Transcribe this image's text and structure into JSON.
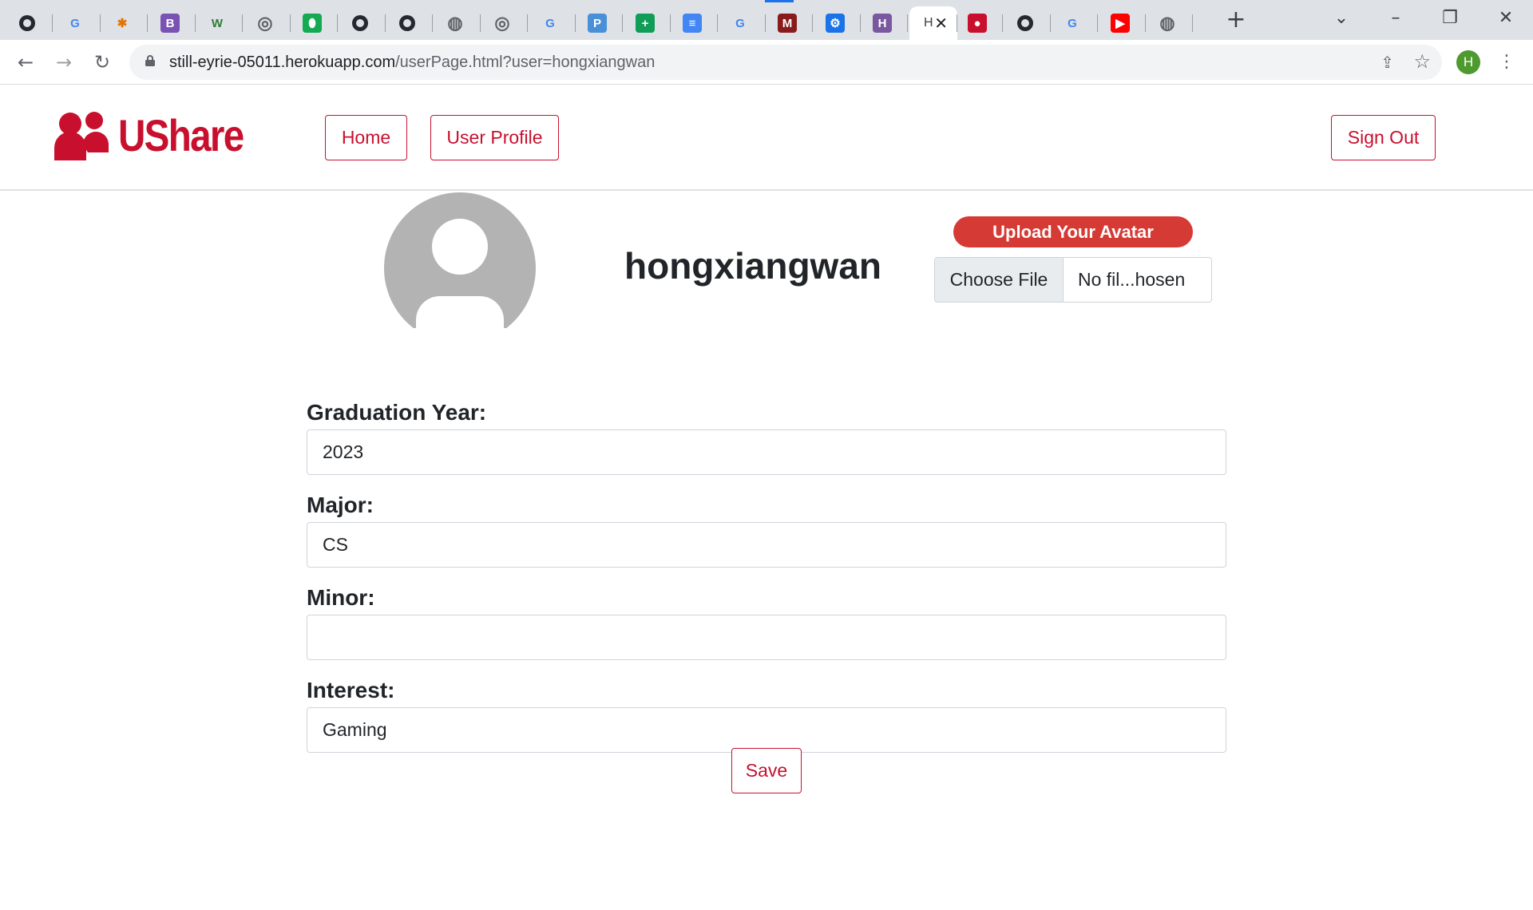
{
  "browser": {
    "tabs": [
      {
        "icon": "github-icon",
        "color": "#24292f",
        "glyph": ""
      },
      {
        "icon": "google-icon",
        "color": "#ffffff",
        "glyph": "G"
      },
      {
        "icon": "sparkle-icon",
        "color": "#ffffff",
        "glyph": "✱"
      },
      {
        "icon": "bootstrap-icon",
        "color": "#7952b3",
        "glyph": "B"
      },
      {
        "icon": "w-icon",
        "color": "#ffffff",
        "glyph": "W"
      },
      {
        "icon": "chrome-icon",
        "color": "#5f6368",
        "glyph": "◎"
      },
      {
        "icon": "mongodb-icon",
        "color": "#13aa52",
        "glyph": "⬮"
      },
      {
        "icon": "github-icon",
        "color": "#24292f",
        "glyph": ""
      },
      {
        "icon": "github-icon",
        "color": "#24292f",
        "glyph": ""
      },
      {
        "icon": "globe-icon",
        "color": "#5f6368",
        "glyph": "◍"
      },
      {
        "icon": "chrome-icon",
        "color": "#5f6368",
        "glyph": "◎"
      },
      {
        "icon": "google-icon",
        "color": "#ffffff",
        "glyph": "G"
      },
      {
        "icon": "p-icon",
        "color": "#4a90d9",
        "glyph": "P"
      },
      {
        "icon": "sheets-icon",
        "color": "#0f9d58",
        "glyph": "+"
      },
      {
        "icon": "docs-icon",
        "color": "#4285f4",
        "glyph": "≡"
      },
      {
        "icon": "google-icon",
        "color": "#ffffff",
        "glyph": "G"
      },
      {
        "icon": "umass-icon",
        "color": "#881c1c",
        "glyph": "M"
      },
      {
        "icon": "gear-icon",
        "color": "#1a73e8",
        "glyph": "⚙"
      },
      {
        "icon": "heroku-icon",
        "color": "#79589f",
        "glyph": "H"
      },
      {
        "icon": "page-icon",
        "color": "#ffffff",
        "glyph": "",
        "active": true,
        "label": "H"
      },
      {
        "icon": "ushare-icon",
        "color": "#c8102e",
        "glyph": "●"
      },
      {
        "icon": "github-icon",
        "color": "#24292f",
        "glyph": ""
      },
      {
        "icon": "google-icon",
        "color": "#ffffff",
        "glyph": "G"
      },
      {
        "icon": "youtube-icon",
        "color": "#ff0000",
        "glyph": "▶"
      },
      {
        "icon": "globe-icon",
        "color": "#5f6368",
        "glyph": "◍"
      }
    ],
    "url_host": "still-eyrie-05011.herokuapp.com",
    "url_path": "/userPage.html?user=hongxiangwan",
    "profile_initial": "H"
  },
  "header": {
    "logo_text": "UShare",
    "nav": {
      "home": "Home",
      "user_profile": "User Profile",
      "sign_out": "Sign Out"
    }
  },
  "profile": {
    "username": "hongxiangwan",
    "upload_label": "Upload Your Avatar",
    "choose_file": "Choose File",
    "no_file": "No fil...hosen"
  },
  "form": {
    "fields": [
      {
        "label": "Graduation Year:",
        "value": "2023"
      },
      {
        "label": "Major:",
        "value": "CS"
      },
      {
        "label": "Minor:",
        "value": ""
      },
      {
        "label": "Interest:",
        "value": "Gaming"
      }
    ],
    "save_label": "Save"
  },
  "colors": {
    "brand": "#c8102e",
    "upload": "#d63a35"
  }
}
